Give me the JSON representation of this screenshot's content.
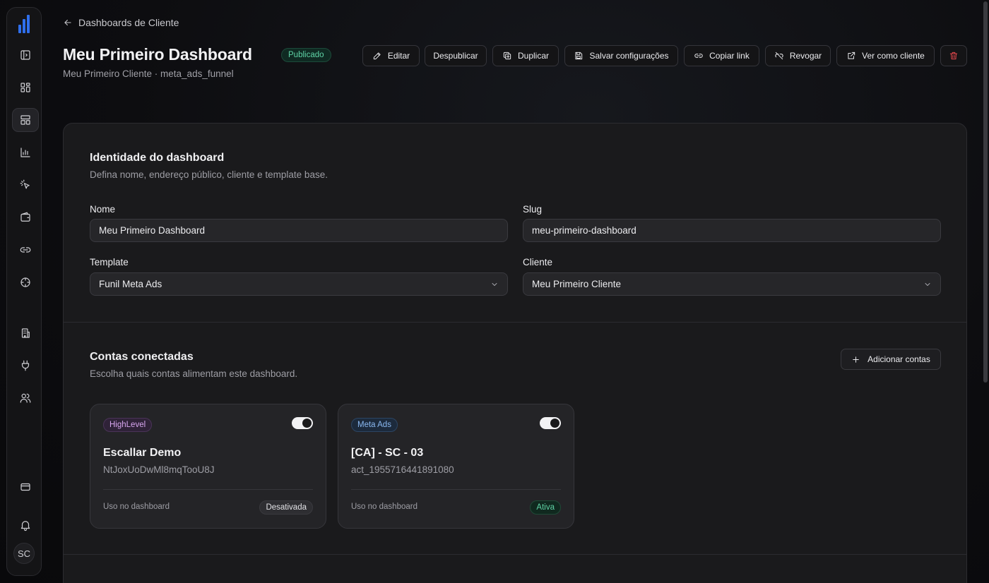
{
  "sidebar": {
    "items": [
      {
        "name": "sidebar-item-panel",
        "icon": "panel-icon"
      },
      {
        "name": "sidebar-item-grid",
        "icon": "grid-icon"
      },
      {
        "name": "sidebar-item-dashboards",
        "icon": "layout-icon",
        "active": true
      },
      {
        "name": "sidebar-item-reports",
        "icon": "bar-chart-icon"
      },
      {
        "name": "sidebar-item-clicks",
        "icon": "pointer-click-icon"
      },
      {
        "name": "sidebar-item-wallet",
        "icon": "wallet-icon"
      },
      {
        "name": "sidebar-item-links",
        "icon": "link-icon"
      },
      {
        "name": "sidebar-item-target",
        "icon": "crosshair-icon"
      },
      {
        "name": "sidebar-item-buildings",
        "icon": "building-icon"
      },
      {
        "name": "sidebar-item-integrations",
        "icon": "plug-icon"
      },
      {
        "name": "sidebar-item-users",
        "icon": "users-icon"
      },
      {
        "name": "sidebar-item-billing",
        "icon": "credit-card-icon"
      },
      {
        "name": "sidebar-item-notifications",
        "icon": "bell-icon"
      }
    ],
    "avatar_initials": "SC"
  },
  "header": {
    "breadcrumb": "Dashboards de Cliente",
    "title": "Meu Primeiro Dashboard",
    "status": "Publicado",
    "subtitle": "Meu Primeiro Cliente · meta_ads_funnel"
  },
  "toolbar": {
    "edit": "Editar",
    "unpublish": "Despublicar",
    "duplicate": "Duplicar",
    "save_settings": "Salvar configurações",
    "copy_link": "Copiar link",
    "revoke": "Revogar",
    "view_as_client": "Ver como cliente"
  },
  "identity": {
    "title": "Identidade do dashboard",
    "description": "Defina nome, endereço público, cliente e template base.",
    "name_label": "Nome",
    "name_value": "Meu Primeiro Dashboard",
    "slug_label": "Slug",
    "slug_value": "meu-primeiro-dashboard",
    "template_label": "Template",
    "template_value": "Funil Meta Ads",
    "client_label": "Cliente",
    "client_value": "Meu Primeiro Cliente"
  },
  "accounts": {
    "title": "Contas conectadas",
    "description": "Escolha quais contas alimentam este dashboard.",
    "add_label": "Adicionar contas",
    "usage_label": "Uso no dashboard",
    "items": [
      {
        "provider": "HighLevel",
        "name": "Escallar Demo",
        "id": "NtJoxUoDwMl8mqTooU8J",
        "enabled": true,
        "state": "Desativada"
      },
      {
        "provider": "Meta Ads",
        "name": "[CA] - SC - 03",
        "id": "act_1955716441891080",
        "enabled": true,
        "state": "Ativa"
      }
    ]
  },
  "colors": {
    "accent": "#2f6fed",
    "success": "#5fd3a6",
    "danger": "#e5484d",
    "highlevel": "#d8a6f0",
    "meta": "#8ab8f0"
  }
}
